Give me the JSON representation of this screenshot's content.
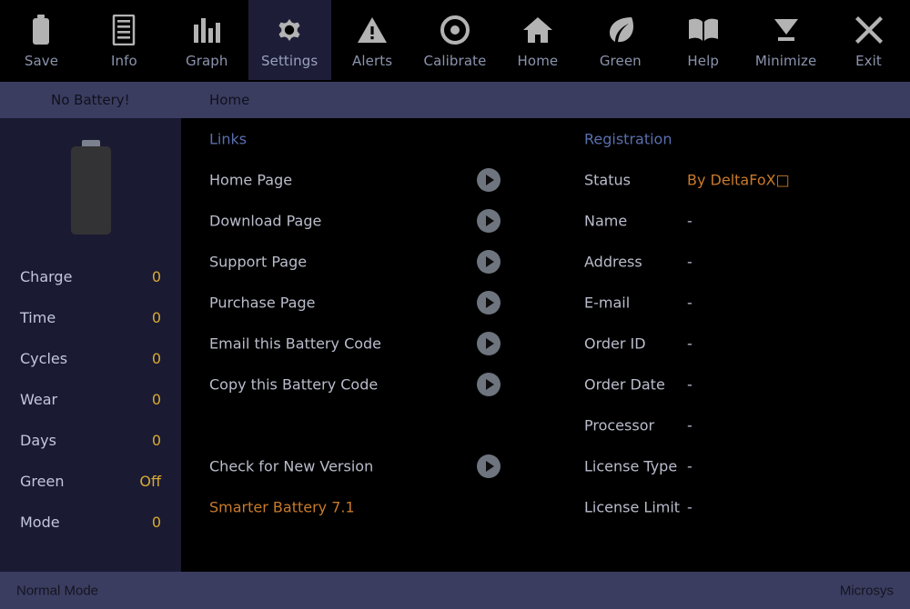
{
  "toolbar": {
    "items": [
      {
        "label": "Save",
        "icon": "battery-icon",
        "active": false
      },
      {
        "label": "Info",
        "icon": "list-icon",
        "active": false
      },
      {
        "label": "Graph",
        "icon": "bars-icon",
        "active": false
      },
      {
        "label": "Settings",
        "icon": "gear-icon",
        "active": true
      },
      {
        "label": "Alerts",
        "icon": "warning-icon",
        "active": false
      },
      {
        "label": "Calibrate",
        "icon": "target-icon",
        "active": false
      },
      {
        "label": "Home",
        "icon": "home-icon",
        "active": false
      },
      {
        "label": "Green",
        "icon": "leaf-icon",
        "active": false
      },
      {
        "label": "Help",
        "icon": "book-icon",
        "active": false
      },
      {
        "label": "Minimize",
        "icon": "minimize-icon",
        "active": false
      },
      {
        "label": "Exit",
        "icon": "close-icon",
        "active": false
      }
    ]
  },
  "subbar": {
    "battery_status": "No Battery!",
    "page": "Home"
  },
  "sidebar": {
    "battery_icon": "battery-empty-icon",
    "stats": [
      {
        "label": "Charge",
        "value": "0"
      },
      {
        "label": "Time",
        "value": "0"
      },
      {
        "label": "Cycles",
        "value": "0"
      },
      {
        "label": "Wear",
        "value": "0"
      },
      {
        "label": "Days",
        "value": "0"
      },
      {
        "label": "Green",
        "value": "Off"
      },
      {
        "label": "Mode",
        "value": "0"
      }
    ]
  },
  "links": {
    "heading": "Links",
    "items": [
      {
        "label": "Home Page",
        "button": "play-icon"
      },
      {
        "label": "Download Page",
        "button": "play-icon"
      },
      {
        "label": "Support Page",
        "button": "play-icon"
      },
      {
        "label": "Purchase Page",
        "button": "play-icon"
      },
      {
        "label": "Email this Battery Code",
        "button": "play-icon"
      },
      {
        "label": "Copy this Battery Code",
        "button": "play-icon"
      }
    ],
    "update": {
      "label": "Check for New Version",
      "button": "play-icon"
    },
    "version": "Smarter Battery 7.1"
  },
  "registration": {
    "heading": "Registration",
    "rows": [
      {
        "label": "Status",
        "value": "By DeltaFoX□",
        "accent": true
      },
      {
        "label": "Name",
        "value": "-",
        "accent": false
      },
      {
        "label": "Address",
        "value": "-",
        "accent": false
      },
      {
        "label": "E-mail",
        "value": "-",
        "accent": false
      },
      {
        "label": "Order ID",
        "value": "-",
        "accent": false
      },
      {
        "label": "Order Date",
        "value": "-",
        "accent": false
      },
      {
        "label": "Processor",
        "value": "-",
        "accent": false
      },
      {
        "label": "License Type",
        "value": "-",
        "accent": false
      },
      {
        "label": "License Limit",
        "value": "-",
        "accent": false
      }
    ]
  },
  "statusbar": {
    "mode": "Normal Mode",
    "vendor": "Microsys"
  },
  "colors": {
    "background": "#000000",
    "sidebar": "#1a1a33",
    "bar": "#3a3d60",
    "active_tab": "#1d1d38",
    "label": "#b9bccb",
    "value_gold": "#d8ab33",
    "heading_blue": "#5a6fae",
    "accent_orange": "#c87a2b",
    "toolbar_label": "#8b94ae",
    "icon_gray": "#b3b3b3"
  }
}
